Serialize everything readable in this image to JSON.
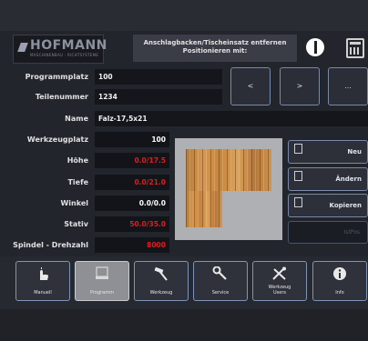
{
  "header": {
    "logo_text": "HOFMANN",
    "logo_subtext": "MASCHINENBAU · RICHTSYSTEME",
    "message": "Anschlagbacken/Tischeinsatz entfernen\nPositionieren mit:"
  },
  "form": {
    "programmplatz": {
      "label": "Programmplatz",
      "value": "100"
    },
    "teilenummer": {
      "label": "Teilenummer",
      "value": "1234"
    },
    "name": {
      "label": "Name",
      "value": "Falz-17,5x21"
    },
    "werkzeugplatz": {
      "label": "Werkzeugplatz",
      "value": "100"
    },
    "hoehe": {
      "label": "Höhe",
      "value": "0.0/17.5"
    },
    "tiefe": {
      "label": "Tiefe",
      "value": "0.0/21.0"
    },
    "winkel": {
      "label": "Winkel",
      "value": "0.0/0.0"
    },
    "stativ": {
      "label": "Stativ",
      "value": "50.0/35.0"
    },
    "spindel": {
      "label": "Spindel - Drehzahl",
      "value": "8000"
    }
  },
  "nav": {
    "prev": "<",
    "next": ">",
    "more": "..."
  },
  "actions": {
    "neu": "Neu",
    "aendern": "Ändern",
    "kopieren": "Kopieren",
    "position": "IstPos"
  },
  "tabs": [
    {
      "label": "Manuell",
      "icon": "hand-icon"
    },
    {
      "label": "Programm",
      "icon": "program-icon"
    },
    {
      "label": "Werkzeug",
      "icon": "hammer-icon"
    },
    {
      "label": "Service",
      "icon": "wrench-icon"
    },
    {
      "label": "Werkzeug\nUsers",
      "icon": "tools-icon"
    },
    {
      "label": "Info",
      "icon": "info-icon"
    }
  ],
  "colors": {
    "background": "#23252d",
    "field": "#14161b",
    "accent_border": "#7f95b8",
    "value_red": "#e01c1c"
  }
}
